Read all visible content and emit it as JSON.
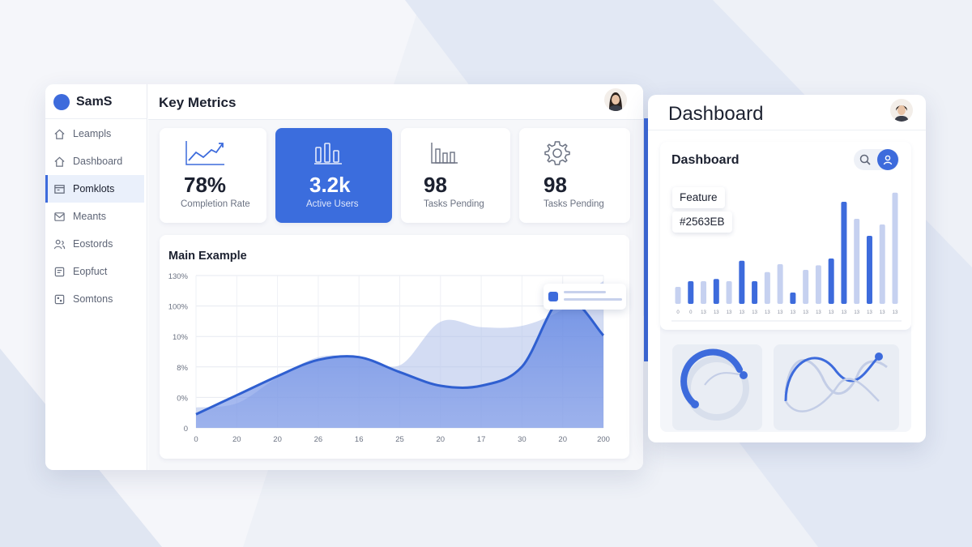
{
  "sidebar": {
    "brand": "SamS",
    "items": [
      {
        "label": "Leampls",
        "icon": "home-icon"
      },
      {
        "label": "Dashboard",
        "icon": "home-icon"
      },
      {
        "label": "Pomklots",
        "icon": "panel-icon",
        "active": true
      },
      {
        "label": "Meants",
        "icon": "mail-icon"
      },
      {
        "label": "Eostords",
        "icon": "users-icon"
      },
      {
        "label": "Eopfuct",
        "icon": "box-icon"
      },
      {
        "label": "Somtons",
        "icon": "grid-icon"
      }
    ]
  },
  "main": {
    "title": "Key Metrics",
    "metrics": [
      {
        "value": "78%",
        "label": "Completion Rate",
        "icon": "trend-chart-icon"
      },
      {
        "value": "3.2k",
        "label": "Active Users",
        "icon": "bar-chart-icon",
        "highlight": true
      },
      {
        "value": "98",
        "label": "Tasks Pending",
        "icon": "column-chart-icon"
      },
      {
        "value": "98",
        "label": "Tasks Pending",
        "icon": "gear-icon"
      }
    ],
    "chart": {
      "title": "Main Example"
    }
  },
  "chart_data": [
    {
      "type": "area",
      "title": "Main Example",
      "y_tick_labels": [
        "130%",
        "100%",
        "10%",
        "8%",
        "0%",
        "0"
      ],
      "x_tick_labels": [
        "0",
        "20",
        "20",
        "26",
        "16",
        "25",
        "20",
        "17",
        "30",
        "20",
        "200"
      ],
      "series": [
        {
          "values": [
            0.75,
            0.9,
            1.85,
            2.6,
            2.6,
            2.3,
            3.9,
            3.7,
            3.75,
            4.35,
            5.4
          ]
        },
        {
          "values": [
            0.5,
            1.2,
            1.9,
            2.5,
            2.6,
            2.05,
            1.55,
            1.55,
            2.25,
            4.8,
            3.4
          ]
        }
      ],
      "colors": {
        "back": "#aebfea",
        "front": "#5d82e3",
        "line": "#2f5fd0"
      }
    },
    {
      "type": "bar",
      "x_tick_labels": [
        "0",
        "0",
        "13",
        "13",
        "13",
        "13",
        "13",
        "13",
        "13",
        "13",
        "13",
        "13",
        "13",
        "13",
        "13",
        "13",
        "13",
        "13"
      ],
      "values": [
        0.15,
        0.2,
        0.2,
        0.22,
        0.2,
        0.38,
        0.2,
        0.28,
        0.35,
        0.1,
        0.3,
        0.34,
        0.4,
        0.9,
        0.75,
        0.6,
        0.7,
        0.98
      ],
      "colors": [
        "#c6d1f0",
        "#3d6bdc",
        "#c6d1f0",
        "#3d6bdc",
        "#c6d1f0",
        "#3d6bdc",
        "#3d6bdc",
        "#c6d1f0",
        "#c6d1f0",
        "#3d6bdc",
        "#c6d1f0",
        "#c6d1f0",
        "#3d6bdc",
        "#3d6bdc",
        "#c6d1f0",
        "#3d6bdc",
        "#c6d1f0",
        "#c6d1f0"
      ]
    }
  ],
  "right": {
    "title": "Dashboard",
    "card_title": "Dashboard",
    "feature_label": "Feature",
    "color_label": "#2563EB",
    "accent": "#2563EB"
  }
}
